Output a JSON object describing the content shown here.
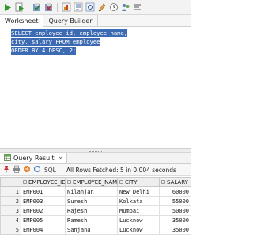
{
  "toolbar": {
    "icons": [
      "run-statement-icon",
      "run-script-icon",
      "commit-icon",
      "rollback-icon",
      "autotrace-icon",
      "explain-plan-icon",
      "sql-tuning-icon",
      "clear-icon",
      "history-icon",
      "unshared-icon",
      "format-icon"
    ]
  },
  "tabs": {
    "worksheet": "Worksheet",
    "query_builder": "Query Builder"
  },
  "editor": {
    "lines": [
      "SELECT employee_id, employee_name,",
      "city, salary FROM employee",
      "ORDER BY 4 DESC, 2;"
    ]
  },
  "result": {
    "tab_label": "Query Result",
    "sql_label": "SQL",
    "status": "All Rows Fetched: 5 in 0.004 seconds",
    "columns": [
      "EMPLOYEE_ID",
      "EMPLOYEE_NAME",
      "CITY",
      "SALARY"
    ],
    "rows": [
      {
        "n": "1",
        "id": "EMP001",
        "name": "Nilanjan",
        "city": "New Delhi",
        "salary": "60000"
      },
      {
        "n": "2",
        "id": "EMP003",
        "name": "Suresh",
        "city": "Kolkata",
        "salary": "55000"
      },
      {
        "n": "3",
        "id": "EMP002",
        "name": "Rajesh",
        "city": "Mumbai",
        "salary": "50000"
      },
      {
        "n": "4",
        "id": "EMP005",
        "name": "Ramesh",
        "city": "Lucknow",
        "salary": "35000"
      },
      {
        "n": "5",
        "id": "EMP004",
        "name": "Sanjana",
        "city": "Lucknow",
        "salary": "35000"
      }
    ]
  }
}
